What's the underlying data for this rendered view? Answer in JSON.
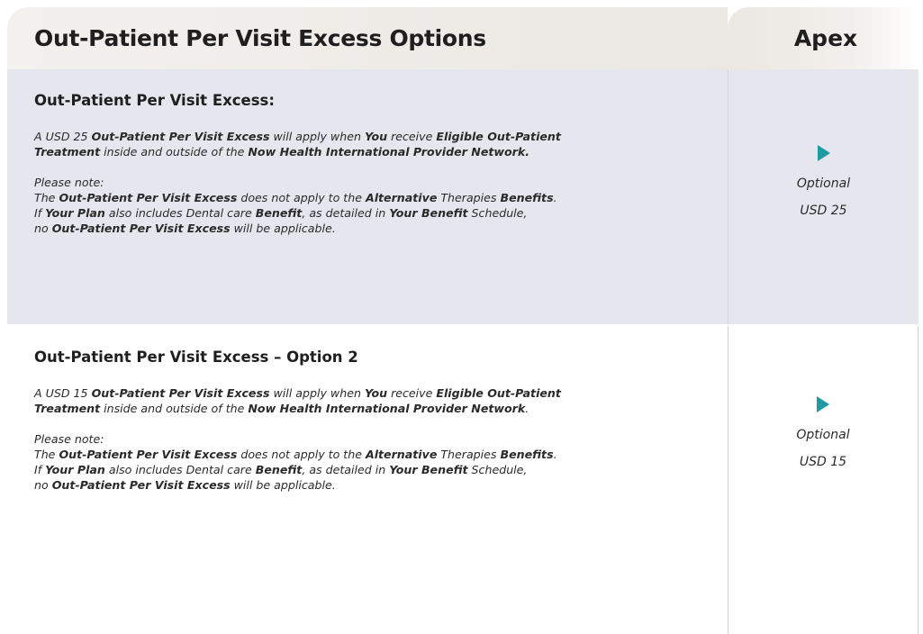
{
  "header": {
    "title": "Out-Patient Per Visit Excess Options",
    "column": "Apex"
  },
  "rows": [
    {
      "title": "Out-Patient Per Visit Excess:",
      "p1": {
        "a": "A USD 25 ",
        "b": "Out-Patient Per Visit Excess",
        "c": " will apply when ",
        "d": "You",
        "e": " receive ",
        "f": "Eligible Out-Patient",
        "g": "Treatment",
        "h": " inside and outside of the ",
        "i": "Now Health International Provider Network."
      },
      "p2": {
        "note": "Please note:",
        "a": "The ",
        "b": "Out-Patient Per Visit Excess",
        "c": " does not apply to the ",
        "d": "Alternative",
        "e": " Therapies ",
        "f": "Benefits",
        "g": ".",
        "h": "If ",
        "i": "Your Plan",
        "j": " also includes Dental care ",
        "k": "Benefit",
        "l": ", as detailed in ",
        "m": "Your Benefit",
        "n": " Schedule,",
        "o": "no ",
        "p": "Out-Patient Per Visit Excess",
        "q": " will be applicable."
      },
      "option": {
        "label": "Optional",
        "value": "USD 25"
      }
    },
    {
      "title": "Out-Patient Per Visit Excess – Option 2",
      "p1": {
        "a": "A USD 15 ",
        "b": "Out-Patient Per Visit Excess",
        "c": " will apply when ",
        "d": "You",
        "e": " receive ",
        "f": "Eligible Out-Patient",
        "g": "Treatment",
        "h": " inside and outside of the ",
        "i": "Now Health International Provider Network",
        "j": "."
      },
      "p2": {
        "note": "Please note:",
        "a": "The ",
        "b": "Out-Patient Per Visit Excess",
        "c": " does not apply to the ",
        "d": "Alternative",
        "e": " Therapies ",
        "f": "Benefits",
        "g": ".",
        "h": "If ",
        "i": "Your Plan",
        "j": " also includes Dental care ",
        "k": "Benefit",
        "l": ", as detailed in ",
        "m": "Your Benefit",
        "n": " Schedule,",
        "o": "no ",
        "p": "Out-Patient Per Visit Excess",
        "q": " will be applicable."
      },
      "option": {
        "label": "Optional",
        "value": "USD 15"
      }
    }
  ],
  "colors": {
    "accent": "#1f9aa0",
    "row_shade": "#e6e6ee",
    "header_bg": "#efece8"
  }
}
